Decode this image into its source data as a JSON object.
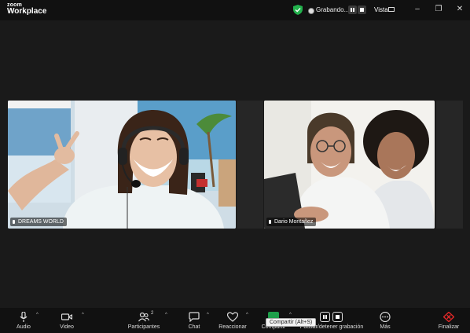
{
  "app": {
    "logo_line1": "zoom",
    "logo_line2": "Workplace"
  },
  "titlebar": {
    "recording_label": "Grabando...",
    "view_label": "Vista",
    "shield_color": "#22b14c"
  },
  "participants": [
    {
      "name": "DREAMS WORLD"
    },
    {
      "name": "Dario Montañez"
    }
  ],
  "toolbar": {
    "audio": "Audio",
    "video": "Video",
    "participants": "Participantes",
    "participants_count": "2",
    "chat": "Chat",
    "react": "Reaccionar",
    "share": "Compartir",
    "share_tooltip": "Compartir (Alt+S)",
    "pause_stop_recording": "Pausar/detener grabación",
    "more": "Más",
    "end": "Finalizar"
  },
  "colors": {
    "background": "#1a1a1a",
    "share_green": "#1e9e4a",
    "end_red": "#e02828"
  }
}
